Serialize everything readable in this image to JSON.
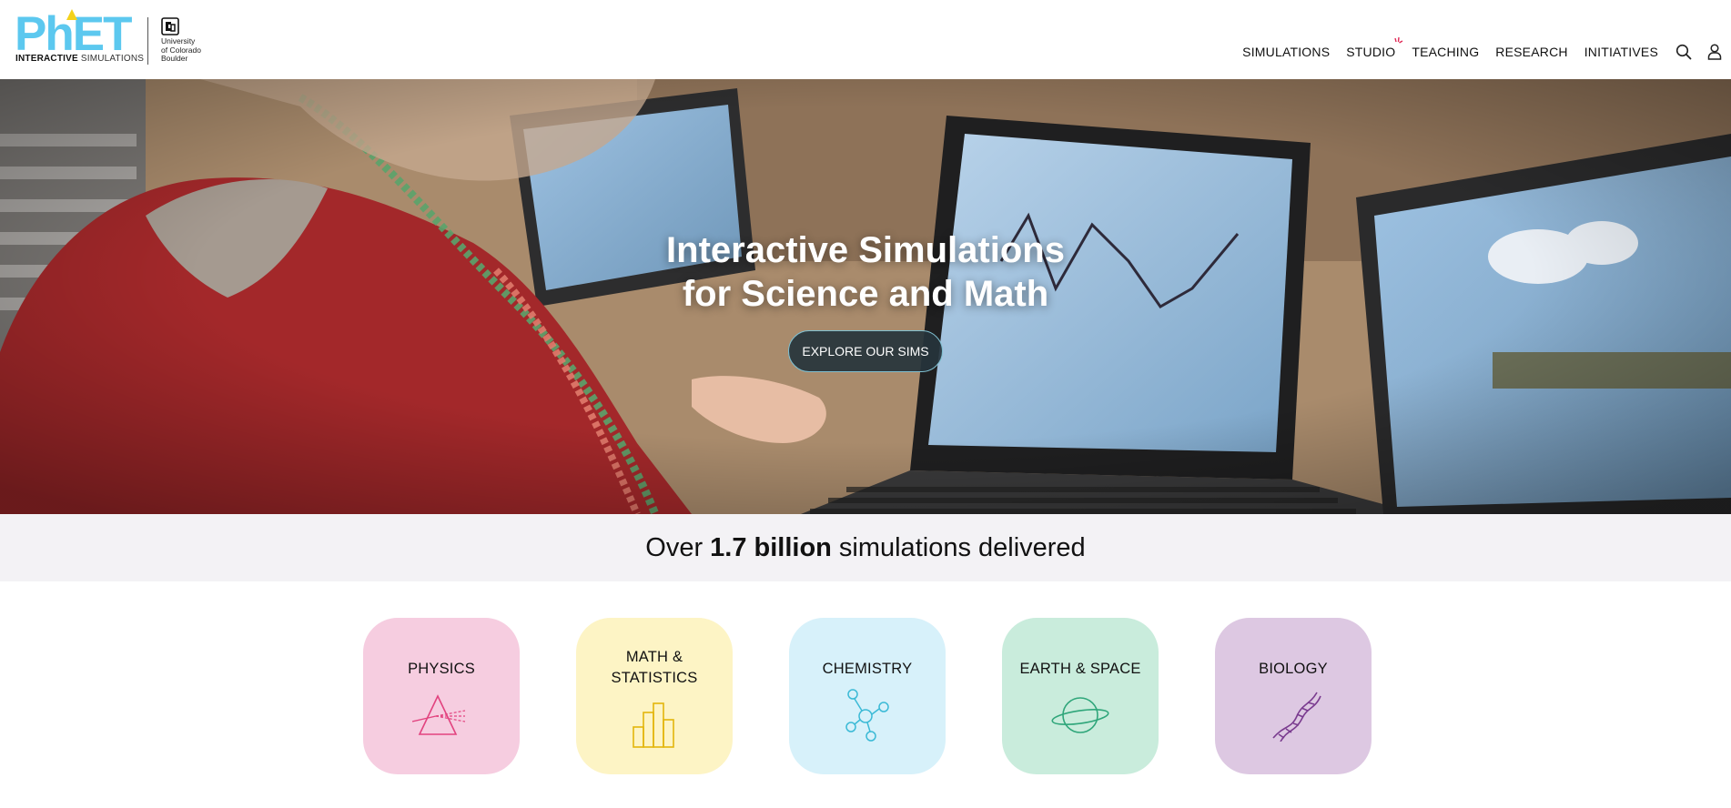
{
  "header": {
    "logo": {
      "word_part1": "Ph",
      "word_part2": "ET",
      "tagline_bold": "INTERACTIVE",
      "tagline_regular": "SIMULATIONS",
      "university_line1": "University",
      "university_line2": "of Colorado",
      "university_line3": "Boulder"
    },
    "nav": [
      {
        "label": "SIMULATIONS"
      },
      {
        "label": "STUDIO"
      },
      {
        "label": "TEACHING"
      },
      {
        "label": "RESEARCH"
      },
      {
        "label": "INITIATIVES"
      }
    ],
    "icons": [
      "search-icon",
      "user-icon"
    ]
  },
  "hero": {
    "title_line1": "Interactive Simulations",
    "title_line2": "for Science and Math",
    "button_label": "EXPLORE OUR SIMS"
  },
  "stats": {
    "prefix": "Over",
    "value": "1.7 billion",
    "suffix": "simulations delivered"
  },
  "subjects": [
    {
      "label": "PHYSICS",
      "icon": "prism-icon",
      "color": "#f6cde0",
      "icon_color": "#e2437f"
    },
    {
      "label_line1": "MATH &",
      "label_line2": "STATISTICS",
      "icon": "bar-chart-icon",
      "color": "#fdf4c5",
      "icon_color": "#e3b50c"
    },
    {
      "label": "CHEMISTRY",
      "icon": "molecule-icon",
      "color": "#d7f1fa",
      "icon_color": "#3bbad6"
    },
    {
      "label": "EARTH & SPACE",
      "icon": "planet-icon",
      "color": "#c9ecdc",
      "icon_color": "#2fa67a"
    },
    {
      "label": "BIOLOGY",
      "icon": "dna-icon",
      "color": "#ddc8e2",
      "icon_color": "#7a3b8f"
    }
  ],
  "colors": {
    "brand_blue": "#5cc8ef",
    "brand_yellow": "#f4d21b",
    "stats_band": "#f3f2f5",
    "button_bg": "#26343c"
  }
}
